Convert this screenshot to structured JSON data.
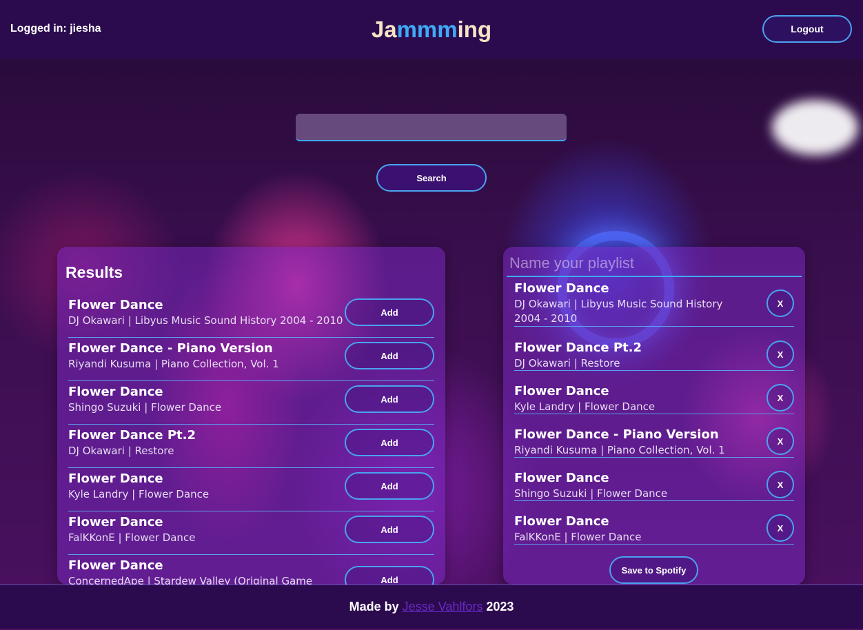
{
  "header": {
    "logged_in": "Logged in: jiesha",
    "brand_part1": "Ja",
    "brand_part2": "mmm",
    "brand_part3": "ing",
    "logout_label": "Logout"
  },
  "search": {
    "value": "",
    "placeholder": "",
    "button_label": "Search"
  },
  "results": {
    "title": "Results",
    "add_label": "Add",
    "tracks": [
      {
        "name": "Flower Dance",
        "sub": "DJ Okawari | Libyus Music Sound History 2004 - 2010"
      },
      {
        "name": "Flower Dance - Piano Version",
        "sub": "Riyandi Kusuma | Piano Collection, Vol. 1"
      },
      {
        "name": "Flower Dance",
        "sub": "Shingo Suzuki | Flower Dance"
      },
      {
        "name": "Flower Dance Pt.2",
        "sub": "DJ Okawari | Restore"
      },
      {
        "name": "Flower Dance",
        "sub": "Kyle Landry | Flower Dance"
      },
      {
        "name": "Flower Dance",
        "sub": "FalKKonE | Flower Dance"
      },
      {
        "name": "Flower Dance",
        "sub": "ConcernedApe | Stardew Valley (Original Game"
      }
    ]
  },
  "playlist": {
    "name_placeholder": "Name your playlist",
    "name_value": "",
    "remove_label": "X",
    "save_label": "Save to Spotify",
    "tracks": [
      {
        "name": "Flower Dance",
        "sub": "DJ Okawari | Libyus Music Sound History 2004 - 2010"
      },
      {
        "name": "Flower Dance Pt.2",
        "sub": "DJ Okawari | Restore"
      },
      {
        "name": "Flower Dance",
        "sub": "Kyle Landry | Flower Dance"
      },
      {
        "name": "Flower Dance - Piano Version",
        "sub": "Riyandi Kusuma | Piano Collection, Vol. 1"
      },
      {
        "name": "Flower Dance",
        "sub": "Shingo Suzuki | Flower Dance"
      },
      {
        "name": "Flower Dance",
        "sub": "FalKKonE | Flower Dance"
      }
    ]
  },
  "footer": {
    "prefix": "Made by",
    "author": "Jesse Vahlfors",
    "year": "2023"
  },
  "colors": {
    "header_bg": "#2b0b4e",
    "accent_blue": "#3fa9f5",
    "brand_cream": "#f7e4c6",
    "author_link": "#6a28c8"
  }
}
